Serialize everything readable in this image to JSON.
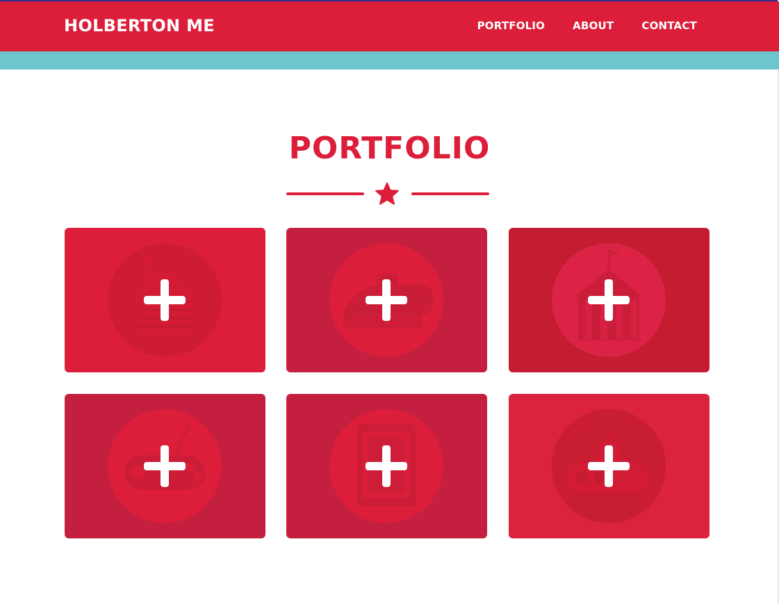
{
  "nav": {
    "brand": "HOLBERTON ME",
    "links": [
      "PORTFOLIO",
      "ABOUT",
      "CONTACT"
    ]
  },
  "section": {
    "title": "PORTFOLIO"
  },
  "colors": {
    "primary": "#dc1e3a",
    "accent": "#6ec6cd",
    "tile_colors": [
      "#dc1e3a",
      "#c51f40",
      "#c41c31",
      "#c51f40",
      "#c51f40",
      "#db233f"
    ]
  },
  "tiles": [
    {
      "icon": "cabin-icon",
      "action": "plus-icon"
    },
    {
      "icon": "cake-icon",
      "action": "plus-icon"
    },
    {
      "icon": "circus-tent-icon",
      "action": "plus-icon"
    },
    {
      "icon": "game-controller-icon",
      "action": "plus-icon"
    },
    {
      "icon": "safe-icon",
      "action": "plus-icon"
    },
    {
      "icon": "submarine-icon",
      "action": "plus-icon"
    }
  ]
}
